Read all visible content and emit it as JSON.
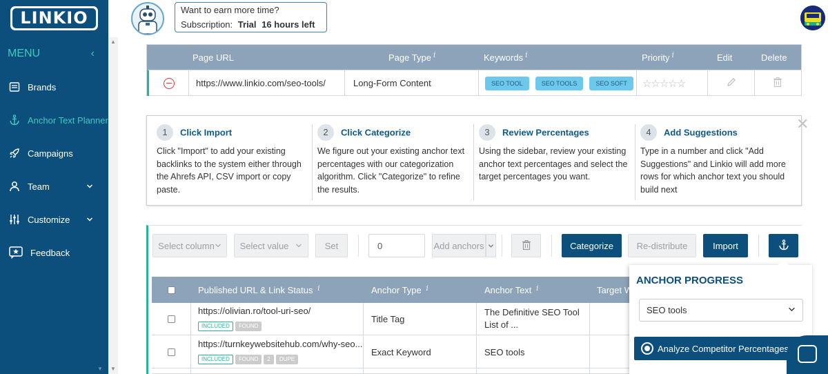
{
  "header": {
    "logo_text": "LINKIO",
    "promo_line1": "Want to earn more time?",
    "promo_label": "Subscription:",
    "promo_plan": "Trial",
    "promo_time": "16 hours left"
  },
  "sidebar": {
    "menu_label": "MENU",
    "items": [
      {
        "label": "Brands",
        "icon": "book-icon"
      },
      {
        "label": "Anchor Text Planner",
        "icon": "anchor-icon",
        "active": true
      },
      {
        "label": "Campaigns",
        "icon": "rocket-icon"
      },
      {
        "label": "Team",
        "icon": "user-icon"
      },
      {
        "label": "Customize",
        "icon": "sliders-icon"
      },
      {
        "label": "Feedback",
        "icon": "star-chat-icon"
      }
    ]
  },
  "keyword_table": {
    "headers": {
      "page_url": "Page URL",
      "page_type": "Page Type",
      "keywords": "Keywords",
      "priority": "Priority",
      "edit": "Edit",
      "delete": "Delete"
    },
    "row": {
      "url": "https://www.linkio.com/seo-tools/",
      "page_type": "Long-Form Content",
      "keywords": [
        "SEO TOOL",
        "SEO TOOLS",
        "SEO SOFT"
      ],
      "priority_stars": 0
    }
  },
  "steps": [
    {
      "num": "1",
      "title": "Click Import",
      "desc": "Click \"Import\" to add your existing backlinks to the system either through the Ahrefs API, CSV import or copy paste."
    },
    {
      "num": "2",
      "title": "Click Categorize",
      "desc": "We figure out your existing anchor text percentages with our categorization algorithm. Click \"Categorize\" to refine the results."
    },
    {
      "num": "3",
      "title": "Review Percentages",
      "desc": "Using the sidebar, review your existing anchor text percentages and select the target percentages you want."
    },
    {
      "num": "4",
      "title": "Add Suggestions",
      "desc": "Type in a number and click \"Add Suggestions\" and Linkio will add more rows for which anchor text you should build next"
    }
  ],
  "toolbar": {
    "select_column": "Select column",
    "select_value": "Select value",
    "set": "Set",
    "number_value": "0",
    "add_anchors": "Add anchors",
    "categorize": "Categorize",
    "redistribute": "Re-distribute",
    "import": "Import"
  },
  "links_table": {
    "headers": {
      "url": "Published URL & Link Status",
      "anchor_type": "Anchor Type",
      "anchor_text": "Anchor Text",
      "target": "Target W"
    },
    "rows": [
      {
        "url": "https://olivian.ro/tool-uri-seo/",
        "badges": [
          "INCLUDED",
          "FOUND"
        ],
        "anchor_type": "Title Tag",
        "anchor_text_1": "The Definitive SEO Tool",
        "anchor_text_2": "List of ..."
      },
      {
        "url": "https://turnkeywebsitehub.com/why-seo...",
        "badges": [
          "INCLUDED",
          "FOUND",
          "2",
          "DUPE"
        ],
        "anchor_type": "Exact Keyword",
        "anchor_text_1": "SEO tools",
        "anchor_text_2": ""
      }
    ]
  },
  "anchor_panel": {
    "title": "ANCHOR PROGRESS",
    "select_value": "SEO tools",
    "analyze_button": "Analyze Competitor Percentages"
  },
  "colors": {
    "primary": "#0d4f7c",
    "accent": "#3fc7c1",
    "table_head": "#8da3ba",
    "keyword_tag": "#6cc9ed",
    "green": "#23b59c"
  }
}
